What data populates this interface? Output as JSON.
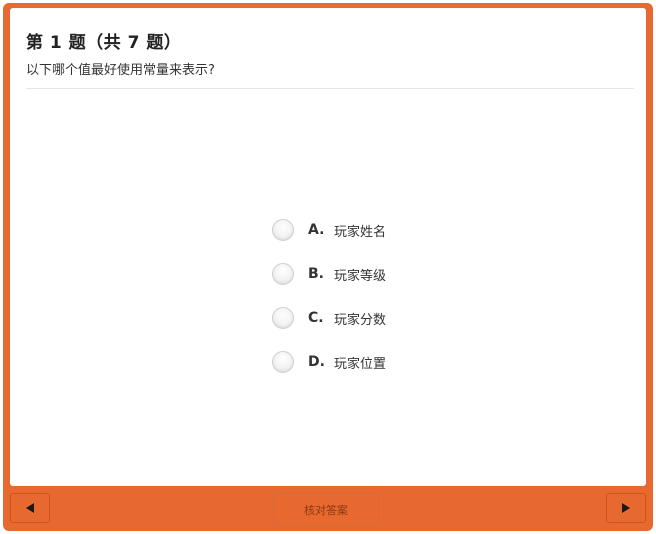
{
  "question": {
    "title": "第 1 题（共 7 题）",
    "text": "以下哪个值最好使用常量来表示?"
  },
  "options": [
    {
      "letter": "A.",
      "text": "玩家姓名"
    },
    {
      "letter": "B.",
      "text": "玩家等级"
    },
    {
      "letter": "C.",
      "text": "玩家分数"
    },
    {
      "letter": "D.",
      "text": "玩家位置"
    }
  ],
  "footer": {
    "check_label": "核对答案",
    "prev_icon": "triangle-left-icon",
    "next_icon": "triangle-right-icon"
  },
  "colors": {
    "accent": "#e8692f",
    "panel": "#ffffff",
    "text": "#333333"
  }
}
